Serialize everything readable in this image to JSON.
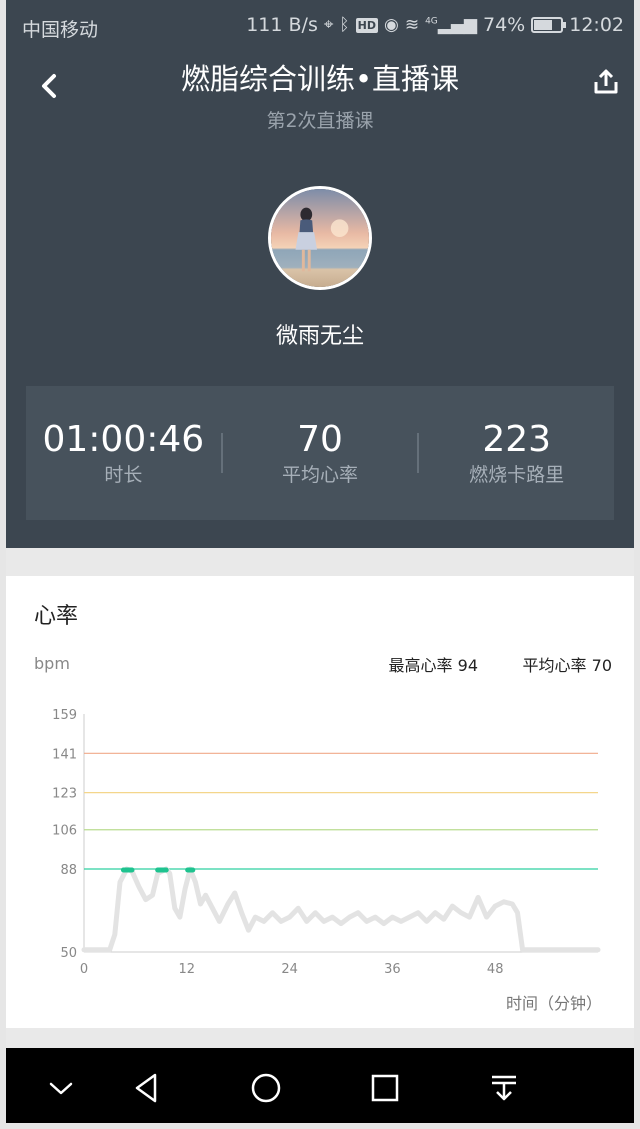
{
  "status_bar": {
    "carrier": "中国移动",
    "network_speed": "111 B/s",
    "hd_badge": "HD",
    "signal_label": "4G",
    "battery_percent": "74%",
    "battery_level": 0.74,
    "time": "12:02"
  },
  "header": {
    "title": "燃脂综合训练•直播课",
    "subtitle": "第2次直播课",
    "username": "微雨无尘"
  },
  "stats": [
    {
      "value": "01:00:46",
      "label": "时长"
    },
    {
      "value": "70",
      "label": "平均心率"
    },
    {
      "value": "223",
      "label": "燃烧卡路里"
    }
  ],
  "heart_rate": {
    "title": "心率",
    "unit": "bpm",
    "max_text": "最高心率 94",
    "avg_text": "平均心率 70",
    "xlabel": "时间（分钟）"
  },
  "colors": {
    "header_bg": "#3c4650",
    "zone_141": "#f0a98a",
    "zone_123": "#f4d68b",
    "zone_106": "#b9dc8f",
    "zone_88": "#2ed1a0",
    "trace": "#e3e3e3",
    "trace_peak": "#1ec38f"
  },
  "chart_data": {
    "type": "line",
    "title": "心率",
    "xlabel": "时间（分钟）",
    "ylabel": "bpm",
    "x_ticks": [
      0,
      12,
      24,
      36,
      48
    ],
    "y_ticks": [
      50,
      88,
      106,
      123,
      141,
      159
    ],
    "xlim": [
      0,
      60
    ],
    "ylim": [
      50,
      159
    ],
    "reference_lines": [
      141,
      123,
      106,
      88
    ],
    "series": [
      {
        "values": [
          [
            0,
            51
          ],
          [
            3,
            51
          ],
          [
            3.6,
            58
          ],
          [
            4.2,
            82
          ],
          [
            5,
            88
          ],
          [
            5.6,
            87
          ],
          [
            6.4,
            80
          ],
          [
            7.2,
            74
          ],
          [
            8,
            76
          ],
          [
            8.6,
            86
          ],
          [
            9.6,
            88
          ],
          [
            10,
            86
          ],
          [
            10.6,
            70
          ],
          [
            11.2,
            66
          ],
          [
            11.8,
            79
          ],
          [
            12.4,
            88
          ],
          [
            13,
            82
          ],
          [
            13.6,
            72
          ],
          [
            14.2,
            76
          ],
          [
            15,
            70
          ],
          [
            15.8,
            64
          ],
          [
            16.8,
            72
          ],
          [
            17.6,
            77
          ],
          [
            18.4,
            68
          ],
          [
            19.2,
            60
          ],
          [
            20,
            66
          ],
          [
            21,
            64
          ],
          [
            22,
            68
          ],
          [
            23,
            64
          ],
          [
            24,
            66
          ],
          [
            25,
            70
          ],
          [
            26,
            64
          ],
          [
            27,
            68
          ],
          [
            28,
            64
          ],
          [
            29,
            66
          ],
          [
            30,
            63
          ],
          [
            31,
            66
          ],
          [
            32,
            68
          ],
          [
            33,
            64
          ],
          [
            34,
            66
          ],
          [
            35,
            63
          ],
          [
            36,
            66
          ],
          [
            37,
            64
          ],
          [
            38,
            66
          ],
          [
            39,
            68
          ],
          [
            40,
            64
          ],
          [
            41,
            68
          ],
          [
            42,
            65
          ],
          [
            43,
            71
          ],
          [
            44,
            68
          ],
          [
            45,
            66
          ],
          [
            46,
            75
          ],
          [
            47,
            66
          ],
          [
            48,
            71
          ],
          [
            49,
            73
          ],
          [
            50,
            72
          ],
          [
            50.6,
            68
          ],
          [
            51.2,
            51
          ],
          [
            60,
            51
          ]
        ]
      }
    ],
    "peak_segments": [
      [
        4.6,
        5.6
      ],
      [
        8.6,
        9.6
      ],
      [
        12.1,
        12.7
      ]
    ]
  }
}
